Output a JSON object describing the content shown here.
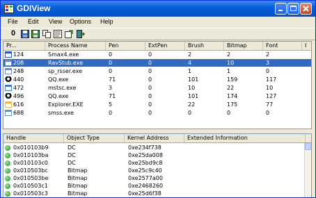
{
  "window": {
    "title": "GDIView",
    "accent": "#0a5fd8",
    "controls": [
      "minimize-icon",
      "maximize-icon",
      "close-icon"
    ]
  },
  "menu": [
    "File",
    "Edit",
    "View",
    "Options",
    "Help"
  ],
  "toolbar": {
    "first_label": "0",
    "icons": [
      "save-icon",
      "save-all-icon",
      "copy-icon",
      "properties-icon",
      "refresh-icon",
      "exit-icon"
    ]
  },
  "processes": {
    "columns": [
      "Pr...",
      "Process Name",
      "Pen",
      "ExtPen",
      "Brush",
      "Bitmap",
      "Font",
      "I"
    ],
    "rows": [
      {
        "pid": "124",
        "name": "Smax4.exe",
        "pen": "0",
        "extpen": "0",
        "brush": "2",
        "bitmap": "2",
        "font": "2",
        "icon": "smax-icon"
      },
      {
        "pid": "208",
        "name": "RavStub.exe",
        "pen": "0",
        "extpen": "0",
        "brush": "4",
        "bitmap": "10",
        "font": "3",
        "icon": "window-icon",
        "selected": true
      },
      {
        "pid": "248",
        "name": "sp_rsser.exe",
        "pen": "0",
        "extpen": "0",
        "brush": "1",
        "bitmap": "1",
        "font": "0",
        "icon": "window-icon"
      },
      {
        "pid": "440",
        "name": "QQ.exe",
        "pen": "71",
        "extpen": "0",
        "brush": "101",
        "bitmap": "159",
        "font": "117",
        "icon": "qq-icon"
      },
      {
        "pid": "472",
        "name": "mstsc.exe",
        "pen": "3",
        "extpen": "0",
        "brush": "10",
        "bitmap": "22",
        "font": "10",
        "icon": "remote-desktop-icon"
      },
      {
        "pid": "496",
        "name": "QQ.exe",
        "pen": "71",
        "extpen": "0",
        "brush": "101",
        "bitmap": "174",
        "font": "127",
        "icon": "qq-icon"
      },
      {
        "pid": "616",
        "name": "Explorer.EXE",
        "pen": "5",
        "extpen": "0",
        "brush": "22",
        "bitmap": "175",
        "font": "77",
        "icon": "explorer-icon"
      },
      {
        "pid": "688",
        "name": "smss.exe",
        "pen": "0",
        "extpen": "0",
        "brush": "0",
        "bitmap": "0",
        "font": "0",
        "icon": "window-icon"
      }
    ]
  },
  "handles": {
    "columns": [
      "Handle",
      "Object Type",
      "Kernel Address",
      "Extended Information"
    ],
    "rows": [
      {
        "handle": "0x010103b9",
        "type": "DC",
        "address": "0xe234f738",
        "info": ""
      },
      {
        "handle": "0x010103ba",
        "type": "DC",
        "address": "0xe25da008",
        "info": ""
      },
      {
        "handle": "0x010103c0",
        "type": "DC",
        "address": "0xe25bd9c8",
        "info": ""
      },
      {
        "handle": "0x010503bc",
        "type": "Bitmap",
        "address": "0xe25c9c40",
        "info": ""
      },
      {
        "handle": "0x010503be",
        "type": "Bitmap",
        "address": "0xe2577a00",
        "info": ""
      },
      {
        "handle": "0x010503c1",
        "type": "Bitmap",
        "address": "0xe2468260",
        "info": ""
      },
      {
        "handle": "0x010503c3",
        "type": "Bitmap",
        "address": "0xe25d6f38",
        "info": ""
      }
    ]
  }
}
